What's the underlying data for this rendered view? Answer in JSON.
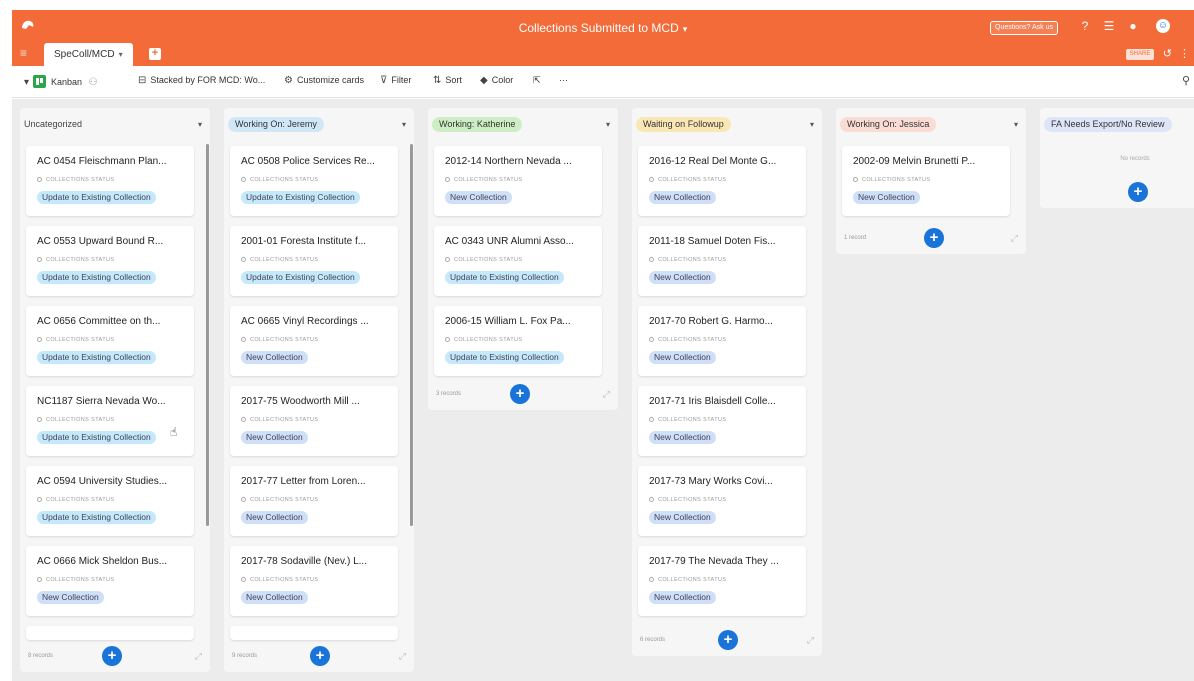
{
  "app": {
    "title": "Collections Submitted to MCD",
    "title_caret": "▾",
    "help_button": "Questions? Ask us",
    "tab_label": "SpeColl/MCD",
    "tab_caret": "▾",
    "add_tab": "+",
    "share_label": "SHARE",
    "icons": [
      "help-icon",
      "list-icon",
      "bell-icon",
      "user-icon"
    ]
  },
  "toolbar": {
    "view_caret": "▾",
    "view_name": "Kanban",
    "view_people_glyph": "⚇",
    "stacked_label": "Stacked by FOR MCD: Wo...",
    "customize_label": "Customize cards",
    "filter_label": "Filter",
    "sort_label": "Sort",
    "color_label": "Color",
    "share_glyph": "⇱",
    "more_glyph": "···",
    "search_glyph": "⚲"
  },
  "columns": [
    {
      "title": "Uncategorized",
      "pill": false,
      "color": "",
      "footer": "8 records",
      "cards": [
        {
          "title": "AC 0454 Fleischmann Plan...",
          "field": "COLLECTIONS STATUS",
          "status": "Update to Existing Collection",
          "kind": "update"
        },
        {
          "title": "AC 0553 Upward Bound R...",
          "field": "COLLECTIONS STATUS",
          "status": "Update to Existing Collection",
          "kind": "update"
        },
        {
          "title": "AC 0656 Committee on th...",
          "field": "COLLECTIONS STATUS",
          "status": "Update to Existing Collection",
          "kind": "update"
        },
        {
          "title": "NC1187 Sierra Nevada Wo...",
          "field": "COLLECTIONS STATUS",
          "status": "Update to Existing Collection",
          "kind": "update"
        },
        {
          "title": "AC 0594 University Studies...",
          "field": "COLLECTIONS STATUS",
          "status": "Update to Existing Collection",
          "kind": "update"
        },
        {
          "title": "AC 0666 Mick Sheldon Bus...",
          "field": "COLLECTIONS STATUS",
          "status": "New Collection",
          "kind": "new"
        }
      ]
    },
    {
      "title": "Working On: Jeremy",
      "pill": true,
      "color": "#cfe7f7",
      "footer": "9 records",
      "cards": [
        {
          "title": "AC 0508 Police Services Re...",
          "field": "COLLECTIONS STATUS",
          "status": "Update to Existing Collection",
          "kind": "update"
        },
        {
          "title": "2001-01 Foresta Institute f...",
          "field": "COLLECTIONS STATUS",
          "status": "Update to Existing Collection",
          "kind": "update"
        },
        {
          "title": "AC 0665 Vinyl Recordings ...",
          "field": "COLLECTIONS STATUS",
          "status": "New Collection",
          "kind": "new"
        },
        {
          "title": "2017-75 Woodworth Mill ...",
          "field": "COLLECTIONS STATUS",
          "status": "New Collection",
          "kind": "new"
        },
        {
          "title": "2017-77 Letter from Loren...",
          "field": "COLLECTIONS STATUS",
          "status": "New Collection",
          "kind": "new"
        },
        {
          "title": "2017-78 Sodaville (Nev.) L...",
          "field": "COLLECTIONS STATUS",
          "status": "New Collection",
          "kind": "new"
        }
      ]
    },
    {
      "title": "Working: Katherine",
      "pill": true,
      "color": "#cdeec4",
      "footer": "3 records",
      "cards": [
        {
          "title": "2012-14 Northern Nevada ...",
          "field": "COLLECTIONS STATUS",
          "status": "New Collection",
          "kind": "new"
        },
        {
          "title": "AC 0343 UNR Alumni Asso...",
          "field": "COLLECTIONS STATUS",
          "status": "Update to Existing Collection",
          "kind": "update"
        },
        {
          "title": "2006-15 William L. Fox Pa...",
          "field": "COLLECTIONS STATUS",
          "status": "Update to Existing Collection",
          "kind": "update"
        }
      ]
    },
    {
      "title": "Waiting on Followup",
      "pill": true,
      "color": "#fbe7b5",
      "footer": "6 records",
      "cards": [
        {
          "title": "2016-12 Real Del Monte G...",
          "field": "COLLECTIONS STATUS",
          "status": "New Collection",
          "kind": "new"
        },
        {
          "title": "2011-18 Samuel Doten Fis...",
          "field": "COLLECTIONS STATUS",
          "status": "New Collection",
          "kind": "new"
        },
        {
          "title": "2017-70 Robert G. Harmo...",
          "field": "COLLECTIONS STATUS",
          "status": "New Collection",
          "kind": "new"
        },
        {
          "title": "2017-71 Iris Blaisdell Colle...",
          "field": "COLLECTIONS STATUS",
          "status": "New Collection",
          "kind": "new"
        },
        {
          "title": "2017-73 Mary Works Covi...",
          "field": "COLLECTIONS STATUS",
          "status": "New Collection",
          "kind": "new"
        },
        {
          "title": "2017-79 The Nevada They ...",
          "field": "COLLECTIONS STATUS",
          "status": "New Collection",
          "kind": "new"
        }
      ]
    },
    {
      "title": "Working On: Jessica",
      "pill": true,
      "color": "#f9dcd3",
      "footer": "1 record",
      "cards": [
        {
          "title": "2002-09 Melvin Brunetti P...",
          "field": "COLLECTIONS STATUS",
          "status": "New Collection",
          "kind": "new"
        }
      ]
    },
    {
      "title": "FA Needs Export/No Review",
      "pill": true,
      "color": "#dde5f7",
      "footer": "",
      "empty_text": "No records",
      "cards": []
    }
  ]
}
